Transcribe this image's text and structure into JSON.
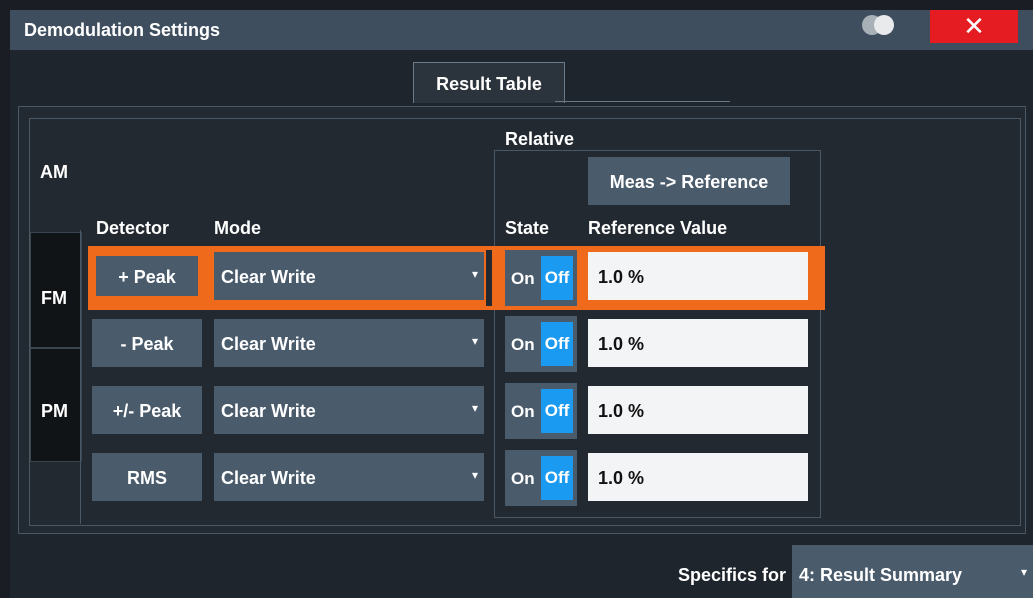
{
  "window": {
    "title": "Demodulation Settings",
    "close_glyph": "✕",
    "close_color": "#e51d22"
  },
  "tabs": [
    {
      "label": "Result Table",
      "active": true
    }
  ],
  "side_tabs": [
    {
      "label": "AM",
      "active": true
    },
    {
      "label": "FM",
      "active": false
    },
    {
      "label": "PM",
      "active": false
    }
  ],
  "headers": {
    "relative": "Relative",
    "detector": "Detector",
    "mode": "Mode",
    "state": "State",
    "reference_value": "Reference Value"
  },
  "meas_ref_button": "Meas -> Reference",
  "rows": [
    {
      "detector": "+ Peak",
      "mode": "Clear Write",
      "on": "On",
      "off": "Off",
      "reference": "1.0 %",
      "selected": true
    },
    {
      "detector": "- Peak",
      "mode": "Clear Write",
      "on": "On",
      "off": "Off",
      "reference": "1.0 %",
      "selected": false
    },
    {
      "detector": "+/- Peak",
      "mode": "Clear Write",
      "on": "On",
      "off": "Off",
      "reference": "1.0 %",
      "selected": false
    },
    {
      "detector": "RMS",
      "mode": "Clear Write",
      "on": "On",
      "off": "Off",
      "reference": "1.0 %",
      "selected": false
    }
  ],
  "footer": {
    "specifics_label": "Specifics for",
    "specifics_value": "4: Result Summary"
  },
  "colors": {
    "highlight": "#f06a1b",
    "toggle_off_active": "#1a9af0"
  },
  "icons": {
    "dropdown_arrow": "▾"
  }
}
